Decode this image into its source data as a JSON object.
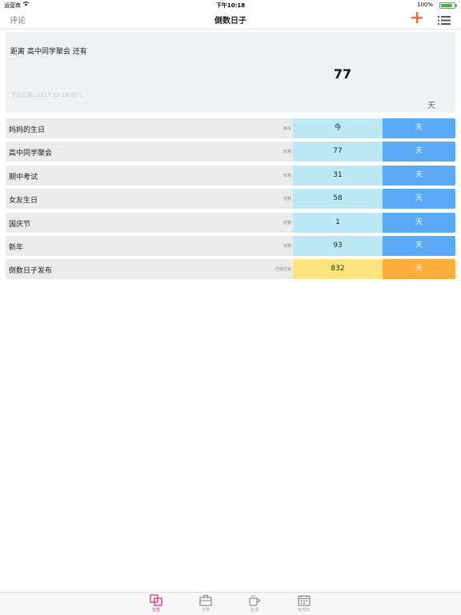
{
  "status_bar": {
    "carrier": "运营商",
    "time": "下午10:18",
    "battery": "100%"
  },
  "nav": {
    "left_label": "评论",
    "title": "倒数日子",
    "add_icon": "plus-icon",
    "menu_icon": "list-icon",
    "accent_color": "#ff6a2c"
  },
  "summary": {
    "label": "距离 高中同学聚会 还有",
    "value": "77",
    "next_date": "下次日期: 2017-12-16 周六",
    "unit": "天"
  },
  "events": [
    {
      "name": "妈妈的生日",
      "status": "就在",
      "value": "今",
      "unit": "天",
      "past": false
    },
    {
      "name": "高中同学聚会",
      "status": "仅剩",
      "value": "77",
      "unit": "天",
      "past": false
    },
    {
      "name": "期中考试",
      "status": "仅剩",
      "value": "31",
      "unit": "天",
      "past": false
    },
    {
      "name": "女友生日",
      "status": "仅剩",
      "value": "58",
      "unit": "天",
      "past": false
    },
    {
      "name": "国庆节",
      "status": "仅剩",
      "value": "1",
      "unit": "天",
      "past": false
    },
    {
      "name": "新年",
      "status": "仅剩",
      "value": "93",
      "unit": "天",
      "past": false
    },
    {
      "name": "倒数日子发布",
      "status": "已经过去",
      "value": "832",
      "unit": "天",
      "past": true
    }
  ],
  "tabs": [
    {
      "label": "全部",
      "icon": "all-icon",
      "active": true
    },
    {
      "label": "工作",
      "icon": "briefcase-icon",
      "active": false
    },
    {
      "label": "生活",
      "icon": "cup-icon",
      "active": false
    },
    {
      "label": "纪念日",
      "icon": "calendar-icon",
      "active": false
    }
  ],
  "colors": {
    "future_count": "#bde8f5",
    "future_unit": "#5aaaf6",
    "past_count": "#ffe580",
    "past_unit": "#ffad3b",
    "tab_active": "#e0327d"
  }
}
